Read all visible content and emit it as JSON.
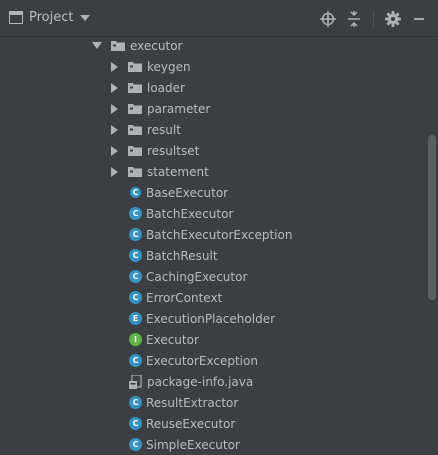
{
  "toolbar": {
    "title": "Project",
    "icons": [
      "project-window-icon",
      "dropdown-caret-icon",
      "locate-icon",
      "collapse-all-icon",
      "settings-gear-icon",
      "hide-panel-icon"
    ]
  },
  "tree": {
    "root": "executor",
    "folders": [
      "keygen",
      "loader",
      "parameter",
      "result",
      "resultset",
      "statement"
    ],
    "files": [
      {
        "name": "BaseExecutor",
        "kind": "abstract-class"
      },
      {
        "name": "BatchExecutor",
        "kind": "class"
      },
      {
        "name": "BatchExecutorException",
        "kind": "class"
      },
      {
        "name": "BatchResult",
        "kind": "class"
      },
      {
        "name": "CachingExecutor",
        "kind": "class"
      },
      {
        "name": "ErrorContext",
        "kind": "class"
      },
      {
        "name": "ExecutionPlaceholder",
        "kind": "enum"
      },
      {
        "name": "Executor",
        "kind": "interface"
      },
      {
        "name": "ExecutorException",
        "kind": "class"
      },
      {
        "name": "package-info.java",
        "kind": "java-file"
      },
      {
        "name": "ResultExtractor",
        "kind": "class"
      },
      {
        "name": "ReuseExecutor",
        "kind": "class"
      },
      {
        "name": "SimpleExecutor",
        "kind": "class"
      }
    ],
    "badge_letters": {
      "class": "C",
      "abstract-class": "C",
      "enum": "E",
      "interface": "I"
    }
  },
  "colors": {
    "background": "#3c3f41",
    "text": "#bbbbbb",
    "class_badge": "#3592c4",
    "interface_badge": "#62b543"
  }
}
